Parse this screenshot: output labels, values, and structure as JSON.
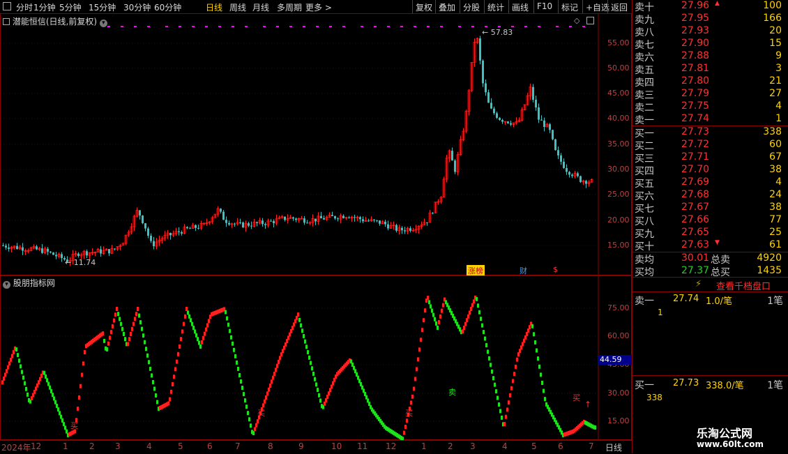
{
  "toolbar": {
    "periods": [
      "分时",
      "1分钟",
      "5分钟",
      "15分钟",
      "30分钟",
      "60分钟",
      "日线",
      "周线",
      "月线",
      "多周期",
      "更多 >"
    ],
    "active": "日线",
    "right": [
      "复权",
      "叠加",
      "分股",
      "统计",
      "画线",
      "F10",
      "标记",
      "+自选",
      "返回"
    ]
  },
  "price_panel": {
    "title": "潜能恒信(日线,前复权)",
    "high_label": "57.83",
    "low_label": "11.74",
    "y_ticks": [
      "55.00",
      "50.00",
      "45.00",
      "40.00",
      "35.00",
      "30.00",
      "25.00",
      "20.00",
      "15.00"
    ],
    "markers": {
      "zhangbang": "涨榜",
      "cai": "财",
      "dollar": "$"
    }
  },
  "indicator_panel": {
    "title": "股朋指标网",
    "y_ticks": [
      "75.00",
      "60.00",
      "45.00",
      "30.00",
      "15.00"
    ],
    "current_value": "44.59",
    "buy": "买",
    "sell": "卖"
  },
  "bottom_axis": {
    "labels": [
      "2024年",
      "12",
      "1",
      "2",
      "3",
      "4",
      "5",
      "6",
      "7",
      "8",
      "9",
      "10",
      "11",
      "12",
      "1",
      "2",
      "3",
      "4",
      "5",
      "6",
      "7"
    ],
    "period": "日线"
  },
  "order_book": {
    "asks": [
      {
        "label": "卖十",
        "price": "27.96",
        "vol": "100",
        "flag": "up"
      },
      {
        "label": "卖九",
        "price": "27.95",
        "vol": "166"
      },
      {
        "label": "卖八",
        "price": "27.93",
        "vol": "20"
      },
      {
        "label": "卖七",
        "price": "27.90",
        "vol": "15"
      },
      {
        "label": "卖六",
        "price": "27.88",
        "vol": "9"
      },
      {
        "label": "卖五",
        "price": "27.81",
        "vol": "3"
      },
      {
        "label": "卖四",
        "price": "27.80",
        "vol": "21"
      },
      {
        "label": "卖三",
        "price": "27.79",
        "vol": "27"
      },
      {
        "label": "卖二",
        "price": "27.75",
        "vol": "4"
      },
      {
        "label": "卖一",
        "price": "27.74",
        "vol": "1"
      }
    ],
    "bids": [
      {
        "label": "买一",
        "price": "27.73",
        "vol": "338"
      },
      {
        "label": "买二",
        "price": "27.72",
        "vol": "60"
      },
      {
        "label": "买三",
        "price": "27.71",
        "vol": "67"
      },
      {
        "label": "买四",
        "price": "27.70",
        "vol": "38"
      },
      {
        "label": "买五",
        "price": "27.69",
        "vol": "4"
      },
      {
        "label": "买六",
        "price": "27.68",
        "vol": "24"
      },
      {
        "label": "买七",
        "price": "27.67",
        "vol": "38"
      },
      {
        "label": "买八",
        "price": "27.66",
        "vol": "77"
      },
      {
        "label": "买九",
        "price": "27.65",
        "vol": "25"
      },
      {
        "label": "买十",
        "price": "27.63",
        "vol": "61",
        "flag": "down"
      }
    ],
    "avg_sell_label": "卖均",
    "avg_sell": "30.01",
    "total_sell_label": "总卖",
    "total_sell": "4920",
    "avg_buy_label": "买均",
    "avg_buy": "27.37",
    "total_buy_label": "总买",
    "total_buy": "1435",
    "depth_button": "查看千档盘口",
    "ask1": {
      "label": "卖一",
      "price": "27.74",
      "qty": "1.0/笔",
      "count": "1笔",
      "detail": "1"
    },
    "bid1": {
      "label": "买一",
      "price": "27.73",
      "qty": "338.0/笔",
      "count": "1笔",
      "detail": "338"
    }
  },
  "watermark": {
    "name": "乐淘公式网",
    "url": "www.60lt.com"
  },
  "colors": {
    "up": "#ff2020",
    "down": "#00dd00",
    "axis": "#c04040",
    "border": "#8b0000",
    "highlight": "#ffd400"
  }
}
